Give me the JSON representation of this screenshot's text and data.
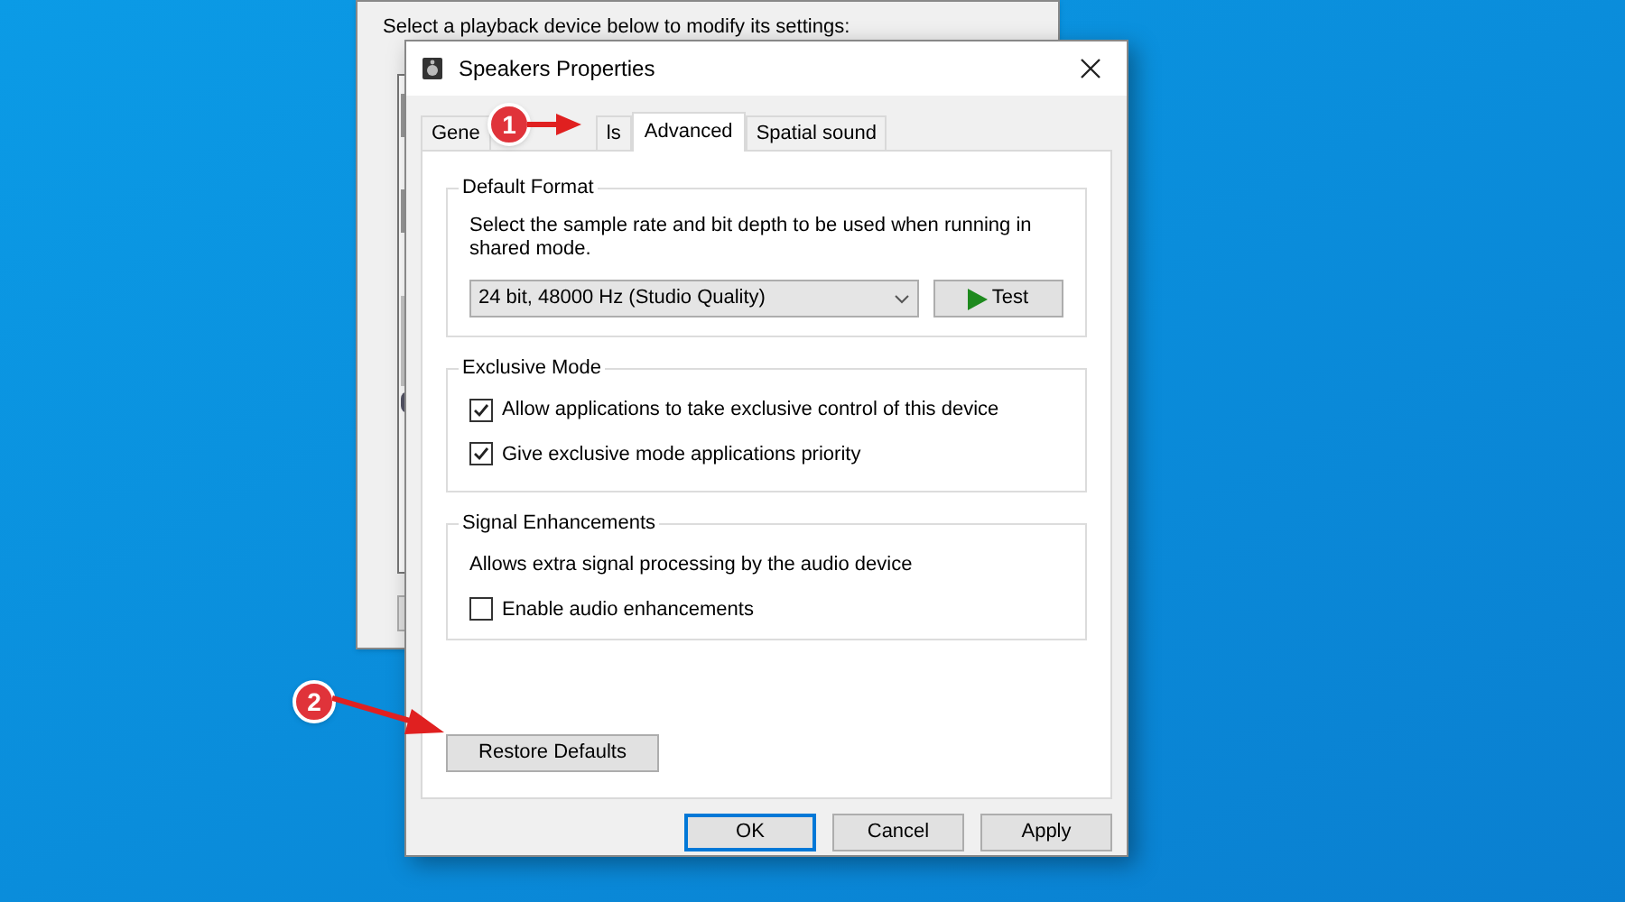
{
  "background_window": {
    "instruction": "Select a playback device below to modify its settings:"
  },
  "window": {
    "title": "Speakers Properties"
  },
  "tabs": [
    {
      "label": "Gene",
      "selected": false
    },
    {
      "label": "ls",
      "selected": false
    },
    {
      "label": "Advanced",
      "selected": true
    },
    {
      "label": "Spatial sound",
      "selected": false
    }
  ],
  "default_format": {
    "heading": "Default Format",
    "description": "Select the sample rate and bit depth to be used when running in shared mode.",
    "format": "24 bit, 48000 Hz (Studio Quality)",
    "test_button": "Test"
  },
  "exclusive_mode": {
    "heading": "Exclusive Mode",
    "options": [
      {
        "label": "Allow applications to take exclusive control of this device",
        "checked": true
      },
      {
        "label": "Give exclusive mode applications priority",
        "checked": true
      }
    ]
  },
  "signal_enhancements": {
    "heading": "Signal Enhancements",
    "description": "Allows extra signal processing by the audio device",
    "options": [
      {
        "label": "Enable audio enhancements",
        "checked": false
      }
    ]
  },
  "restore_button": "Restore Defaults",
  "buttons": [
    {
      "label": "OK",
      "selected": true
    },
    {
      "label": "Cancel",
      "selected": false
    },
    {
      "label": "Apply",
      "selected": false
    }
  ],
  "annotations": [
    "1",
    "2"
  ]
}
